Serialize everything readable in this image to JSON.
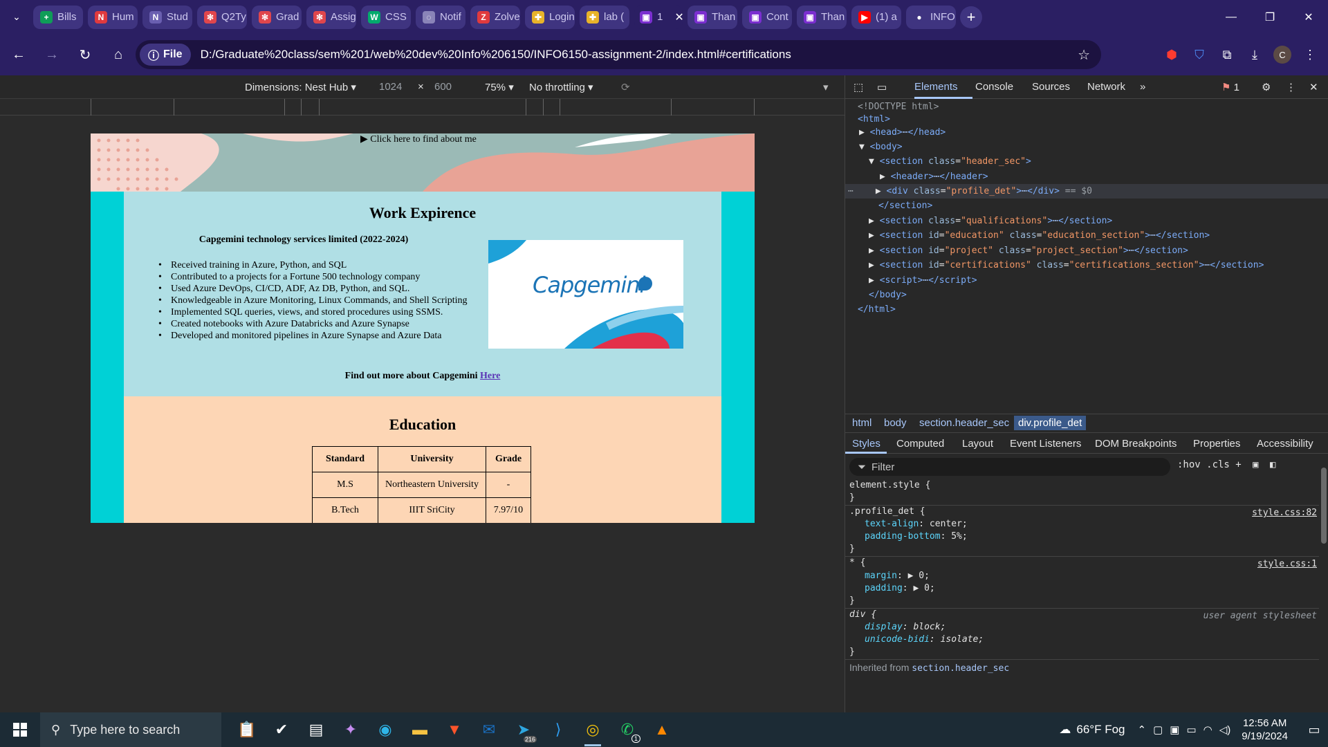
{
  "browser": {
    "tabs": [
      {
        "label": "Bills",
        "icon": "sheets-icon",
        "color": "#0f9d58"
      },
      {
        "label": "Hum",
        "icon": "notion-icon",
        "color": "#e03a3e"
      },
      {
        "label": "Stud",
        "icon": "notion-icon",
        "color": "#6a5fb0"
      },
      {
        "label": "Q2Ty",
        "icon": "snowflake-icon",
        "color": "#e0464c"
      },
      {
        "label": "Grad",
        "icon": "snowflake-icon",
        "color": "#e0464c"
      },
      {
        "label": "Assig",
        "icon": "snowflake-icon",
        "color": "#e0464c"
      },
      {
        "label": "CSS",
        "icon": "w3schools-icon",
        "color": "#04aa6d"
      },
      {
        "label": "Notif",
        "icon": "globe-icon",
        "color": "#8a84b8"
      },
      {
        "label": "Zolve",
        "icon": "zolve-icon",
        "color": "#e03a3e"
      },
      {
        "label": "Login",
        "icon": "slack-icon",
        "color": "#e8b32a"
      },
      {
        "label": "lab (",
        "icon": "slack-icon",
        "color": "#e8b32a"
      },
      {
        "label": "1",
        "icon": "app-icon",
        "color": "#7b2fd0"
      },
      {
        "label": "Than",
        "icon": "app-icon",
        "color": "#7b2fd0"
      },
      {
        "label": "Cont",
        "icon": "app-icon",
        "color": "#7b2fd0"
      },
      {
        "label": "Than",
        "icon": "app-icon",
        "color": "#7b2fd0"
      },
      {
        "label": "(1) a",
        "icon": "youtube-icon",
        "color": "#ff0000"
      },
      {
        "label": "INFO",
        "icon": "github-icon",
        "color": "#ffffff"
      }
    ],
    "site_chip": "File",
    "url": "D:/Graduate%20class/sem%201/web%20dev%20Info%206150/INFO6150-assignment-2/index.html#certifications",
    "avatar_letter": "C"
  },
  "device_toolbar": {
    "dimensions": "Dimensions: Nest Hub ▾",
    "width": "1024",
    "times": "×",
    "height": "600",
    "zoom": "75% ▾",
    "throttling": "No throttling ▾"
  },
  "page": {
    "hero_text": "▶ Click here to find about me",
    "work_title": "Work Expirence",
    "company": "Capgemini technology services limited (2022-2024)",
    "bullets": [
      "Received training in Azure, Python, and SQL",
      "Contributed to a projects for a Fortune 500 technology company",
      "Used Azure DevOps, CI/CD, ADF, Az DB, Python, and SQL.",
      "Knowledgeable in Azure Monitoring, Linux Commands, and Shell Scripting",
      "Implemented SQL queries, views, and stored procedures using SSMS.",
      "Created notebooks with Azure Databricks and Azure Synapse",
      "Developed and monitored pipelines in Azure Synapse and Azure Data"
    ],
    "logo_text": "Capgemini",
    "find_more": "Find out more about Capgemini",
    "find_more_link": "Here",
    "education_title": "Education",
    "education_headers": [
      "Standard",
      "University",
      "Grade"
    ],
    "education_rows": [
      [
        "M.S",
        "Northeastern University",
        "-"
      ],
      [
        "B.Tech",
        "IIIT SriCity",
        "7.97/10"
      ]
    ]
  },
  "devtools": {
    "tabs": [
      "Elements",
      "Console",
      "Sources",
      "Network"
    ],
    "more": "»",
    "issues": "1",
    "dom": {
      "doctype": "<!DOCTYPE html>",
      "html_open": "<html>",
      "head": "head",
      "body": "body",
      "section": "section",
      "class_attr": "class",
      "id_attr": "id",
      "header_sec": "\"header_sec\"",
      "header": "header",
      "div": "div",
      "profile_det": "\"profile_det\"",
      "eq_sel": "== $0",
      "qualifications": "\"qualifications\"",
      "education": "\"education\"",
      "education_section": "\"education_section\"",
      "project": "\"project\"",
      "project_section": "\"project_section\"",
      "certifications": "\"certifications\"",
      "certifications_section": "\"certifications_section\"",
      "script": "script",
      "body_close": "</body>",
      "html_close": "</html>",
      "section_close": "</section>",
      "ellipsis": "⋯"
    },
    "breadcrumbs": [
      "html",
      "body",
      "section.header_sec",
      "div.profile_det"
    ],
    "styles_tabs": [
      "Styles",
      "Computed",
      "Layout",
      "Event Listeners",
      "DOM Breakpoints",
      "Properties",
      "Accessibility"
    ],
    "filter_placeholder": "Filter",
    "filter_tools": ":hov  .cls  +",
    "rules": {
      "element_style": "element.style {",
      "close": "}",
      "profile_selector": ".profile_det {",
      "profile_src": "style.css:82",
      "text_align_prop": "text-align",
      "text_align_val": ": center;",
      "padding_bottom_prop": "padding-bottom",
      "padding_bottom_val": ": 5%;",
      "universal_selector": "* {",
      "universal_src": "style.css:1",
      "margin_prop": "margin",
      "margin_val": ": ▶ 0;",
      "padding_prop": "padding",
      "padding_val": ": ▶ 0;",
      "div_selector": "div {",
      "ua_label": "user agent stylesheet",
      "display_prop": "display",
      "display_val": ": block;",
      "unicode_prop": "unicode-bidi",
      "unicode_val": ": isolate;",
      "inherited_label": "Inherited from",
      "inherited_selector": "section.header_sec"
    }
  },
  "taskbar": {
    "search_placeholder": "Type here to search",
    "weather": "66°F Fog",
    "time": "12:56 AM",
    "date": "9/19/2024",
    "telegram_badge": "216",
    "whatsapp_badge": "1"
  }
}
